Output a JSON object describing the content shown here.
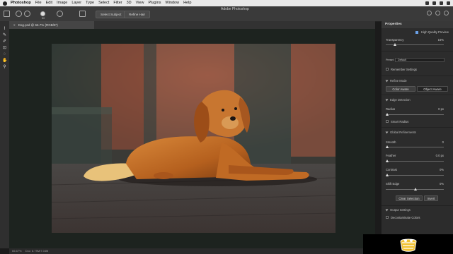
{
  "menubar": {
    "app": "Photoshop",
    "items": [
      "File",
      "Edit",
      "Image",
      "Layer",
      "Type",
      "Select",
      "Filter",
      "3D",
      "View",
      "Plugins",
      "Window",
      "Help"
    ]
  },
  "options_bar": {
    "window_title": "Adobe Photoshop",
    "size_value": "50",
    "select_subject": "Select Subject",
    "refine_hair": "Refine Hair"
  },
  "document": {
    "tab_title": "Dog.psd @ 66.7% (RGB/8*)",
    "close_glyph": "×"
  },
  "status": {
    "zoom": "66.67%",
    "doc_size": "Doc: 8.79M/7.04M"
  },
  "properties": {
    "title": "Properties",
    "high_quality_preview": "High Quality Preview",
    "transparency_label": "Transparency",
    "transparency_value": "16%",
    "transparency_level": 0.16,
    "preset_label": "Preset",
    "preset_value": "Default",
    "remember_settings": "Remember Settings",
    "refine_mode": "Refine Mode",
    "color_aware": "Color Aware",
    "object_aware": "Object Aware",
    "edge_detection": "Edge Detection",
    "radius_label": "Radius",
    "radius_value": "0 px",
    "smart_radius": "Smart Radius",
    "global_refinements": "Global Refinements",
    "smooth_label": "Smooth",
    "smooth_value": "0",
    "feather_label": "Feather",
    "feather_value": "0.0 px",
    "contrast_label": "Contrast",
    "contrast_value": "0%",
    "shift_edge_label": "Shift Edge",
    "shift_edge_value": "0%",
    "clear_selection": "Clear Selection",
    "invert": "Invert",
    "output_settings": "Output Settings",
    "decontaminate": "Decontaminate Colors"
  },
  "colors": {
    "accent": "#6aa0e6",
    "canvas_bg": "#1d231f",
    "panel_bg": "#2c2c2c"
  }
}
